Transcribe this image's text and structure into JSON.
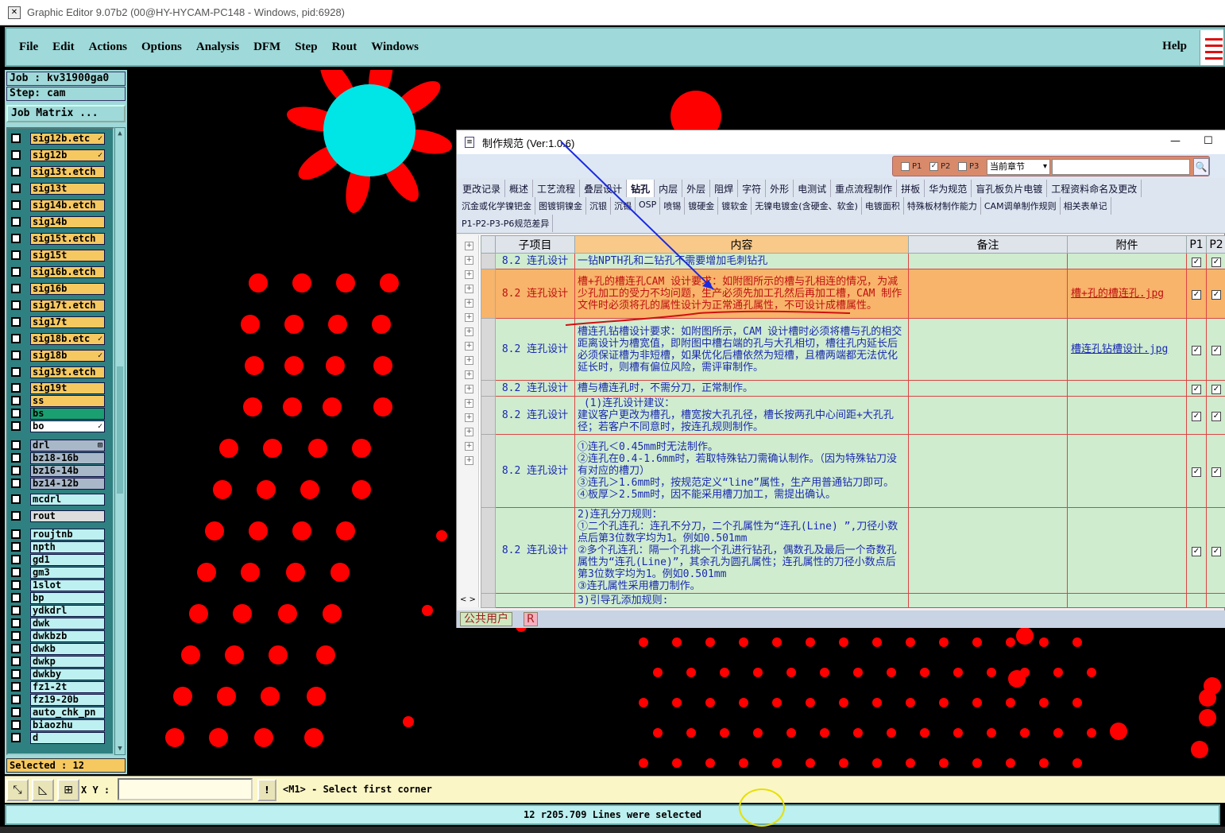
{
  "window": {
    "title": "Graphic Editor 9.07b2 (00@HY-HYCAM-PC148 - Windows, pid:6928)"
  },
  "menu": [
    "File",
    "Edit",
    "Actions",
    "Options",
    "Analysis",
    "DFM",
    "Step",
    "Rout",
    "Windows"
  ],
  "help_label": "Help",
  "job": {
    "job_label": "Job : kv31900ga0",
    "step_label": "Step: cam",
    "matrix_button": "Job Matrix ..."
  },
  "layers": [
    {
      "name": "sig12b.etc",
      "color": "#f6c860",
      "mark": "✓"
    },
    {
      "name": "sig12b",
      "color": "#f6c860",
      "mark": "✓"
    },
    {
      "name": "sig13t.etch",
      "color": "#f6c860",
      "mark": ""
    },
    {
      "name": "sig13t",
      "color": "#f6c860",
      "mark": ""
    },
    {
      "name": "sig14b.etch",
      "color": "#f6c860",
      "mark": ""
    },
    {
      "name": "sig14b",
      "color": "#f6c860",
      "mark": ""
    },
    {
      "name": "sig15t.etch",
      "color": "#f6c860",
      "mark": ""
    },
    {
      "name": "sig15t",
      "color": "#f6c860",
      "mark": ""
    },
    {
      "name": "sig16b.etch",
      "color": "#f6c860",
      "mark": ""
    },
    {
      "name": "sig16b",
      "color": "#f6c860",
      "mark": ""
    },
    {
      "name": "sig17t.etch",
      "color": "#f6c860",
      "mark": ""
    },
    {
      "name": "sig17t",
      "color": "#f6c860",
      "mark": ""
    },
    {
      "name": "sig18b.etc",
      "color": "#f6c860",
      "mark": "✓"
    },
    {
      "name": "sig18b",
      "color": "#f6c860",
      "mark": "✓"
    },
    {
      "name": "sig19t.etch",
      "color": "#f6c860",
      "mark": ""
    },
    {
      "name": "sig19t",
      "color": "#f6c860",
      "mark": ""
    },
    {
      "name": "ss",
      "color": "#f6c860",
      "mark": ""
    },
    {
      "name": "bs",
      "color": "#1aa070",
      "mark": ""
    },
    {
      "name": "bo",
      "color": "#ffffff",
      "mark": "✓"
    },
    {
      "name": "drl",
      "color": "#a8b8c8",
      "mark": "⊞"
    },
    {
      "name": "bz18-16b",
      "color": "#a8b8c8",
      "mark": ""
    },
    {
      "name": "bz16-14b",
      "color": "#a8b8c8",
      "mark": ""
    },
    {
      "name": "bz14-12b",
      "color": "#a8b8c8",
      "mark": ""
    },
    {
      "name": "mcdrl",
      "color": "#bdf0f0",
      "mark": ""
    },
    {
      "name": "rout",
      "color": "#dddddd",
      "mark": ""
    },
    {
      "name": "roujtnb",
      "color": "#bdf0f0",
      "mark": ""
    },
    {
      "name": "npth",
      "color": "#bdf0f0",
      "mark": ""
    },
    {
      "name": "gd1",
      "color": "#bdf0f0",
      "mark": ""
    },
    {
      "name": "gm3",
      "color": "#bdf0f0",
      "mark": ""
    },
    {
      "name": "1slot",
      "color": "#bdf0f0",
      "mark": ""
    },
    {
      "name": "bp",
      "color": "#bdf0f0",
      "mark": ""
    },
    {
      "name": "ydkdrl",
      "color": "#bdf0f0",
      "mark": ""
    },
    {
      "name": "dwk",
      "color": "#bdf0f0",
      "mark": ""
    },
    {
      "name": "dwkbzb",
      "color": "#bdf0f0",
      "mark": ""
    },
    {
      "name": "dwkb",
      "color": "#bdf0f0",
      "mark": ""
    },
    {
      "name": "dwkp",
      "color": "#bdf0f0",
      "mark": ""
    },
    {
      "name": "dwkby",
      "color": "#bdf0f0",
      "mark": ""
    },
    {
      "name": "fz1-2t",
      "color": "#bdf0f0",
      "mark": ""
    },
    {
      "name": "fz19-20b",
      "color": "#bdf0f0",
      "mark": ""
    },
    {
      "name": "auto_chk_pn",
      "color": "#bdf0f0",
      "mark": ""
    },
    {
      "name": "biaozhu",
      "color": "#bdf0f0",
      "mark": ""
    },
    {
      "name": "d",
      "color": "#bdf0f0",
      "mark": ""
    }
  ],
  "selected_label": "Selected : 12",
  "cmd": {
    "xy_label": "X Y :",
    "xy_value": "",
    "exclaim": "!",
    "prompt": "<M1> - Select first corner"
  },
  "status": "12 r205.709 Lines were selected",
  "dialog": {
    "title": "制作规范 (Ver:1.0.6)",
    "filters": [
      {
        "label": "P1",
        "checked": false
      },
      {
        "label": "P2",
        "checked": true
      },
      {
        "label": "P3",
        "checked": false
      }
    ],
    "chapter": "当前章节",
    "tabs_row1": [
      "更改记录",
      "概述",
      "工艺流程",
      "叠层设计",
      "钻孔",
      "内层",
      "外层",
      "阻焊",
      "字符",
      "外形",
      "电测试",
      "重点流程制作",
      "拼板",
      "华为规范",
      "盲孔板负片电镀",
      "工程资料命名及更改"
    ],
    "tabs_row2": [
      "沉金或化学镍钯金",
      "图镀铜镍金",
      "沉银",
      "沉锡",
      "OSP",
      "喷锡",
      "镀硬金",
      "镀软金",
      "无镍电镀金(含硬金、软金)",
      "电镀面积",
      "特殊板材制作能力",
      "CAM调单制作规则",
      "相关表单记"
    ],
    "tabs_row3": [
      "P1-P2-P3-P6规范差异"
    ],
    "active_tab": "钻孔",
    "columns": [
      "子项目",
      "内容",
      "备注",
      "附件",
      "P1",
      "P2"
    ],
    "rows": [
      {
        "sub": "8.2 连孔设计",
        "content": "一钻NPTH孔和二钻孔不需要增加毛刺钻孔",
        "note": "",
        "attach": "",
        "p1": true,
        "p2": true
      },
      {
        "sub": "8.2 连孔设计",
        "content": "槽+孔的槽连孔CAM 设计要求：如附图所示的槽与孔相连的情况，为减少孔加工的受力不均问题，生产必须先加工孔然后再加工槽，CAM 制作文件时必须将孔的属性设计为正常通孔属性，不可设计成槽属性。",
        "note": "",
        "attach": "槽+孔的槽连孔.jpg",
        "p1": true,
        "p2": true
      },
      {
        "sub": "8.2 连孔设计",
        "content": "槽连孔钻槽设计要求：如附图所示，CAM 设计槽时必须将槽与孔的相交距离设计为槽宽值，即附图中槽右端的孔与大孔相切，槽往孔内延长后必须保证槽为非短槽，如果优化后槽依然为短槽，且槽两端都无法优化延长时，则槽有偏位风险，需评审制作。",
        "note": "",
        "attach": "槽连孔钻槽设计.jpg",
        "p1": true,
        "p2": true
      },
      {
        "sub": "8.2 连孔设计",
        "content": "槽与槽连孔时，不需分刀，正常制作。",
        "note": "",
        "attach": "",
        "p1": true,
        "p2": true
      },
      {
        "sub": "8.2 连孔设计",
        "content": " (1)连孔设计建议：\n建议客户更改为槽孔，槽宽按大孔孔径，槽长按两孔中心间距+大孔孔径；若客户不同意时，按连孔规则制作。",
        "note": "",
        "attach": "",
        "p1": true,
        "p2": true
      },
      {
        "sub": "8.2 连孔设计",
        "content": "①连孔＜0.45mm时无法制作。\n②连孔在0.4-1.6mm时，若取特殊钻刀需确认制作。（因为特殊钻刀没有对应的槽刀）\n③连孔＞1.6mm时，按规范定义“line”属性，生产用普通钻刀即可。\n④板厚＞2.5mm时，因不能采用槽刀加工，需提出确认。",
        "note": "",
        "attach": "",
        "p1": true,
        "p2": true
      },
      {
        "sub": "8.2 连孔设计",
        "content": "2)连孔分刀规则：\n①二个孔连孔：连孔不分刀，二个孔属性为“连孔(Line) ”,刀径小数点后第3位数字均为1。例如0.501mm\n②多个孔连孔：隔一个孔挑一个孔进行钻孔，偶数孔及最后一个奇数孔属性为“连孔(Line)”，其余孔为圆孔属性；连孔属性的刀径小数点后第3位数字均为1。例如0.501mm\n③连孔属性采用槽刀制作。",
        "note": "",
        "attach": "",
        "p1": true,
        "p2": true
      },
      {
        "sub": "",
        "content": "3)引导孔添加规则:",
        "note": "",
        "attach": "",
        "p1": false,
        "p2": false
      }
    ],
    "footer_user": "公共用户",
    "footer_role": "R"
  },
  "colors": {
    "canvas_bg": "#000000",
    "pad": "#ff0000",
    "flower_center": "#00e5e5",
    "menubar": "#9fd9d9",
    "selected_row": "#f7b46a"
  }
}
